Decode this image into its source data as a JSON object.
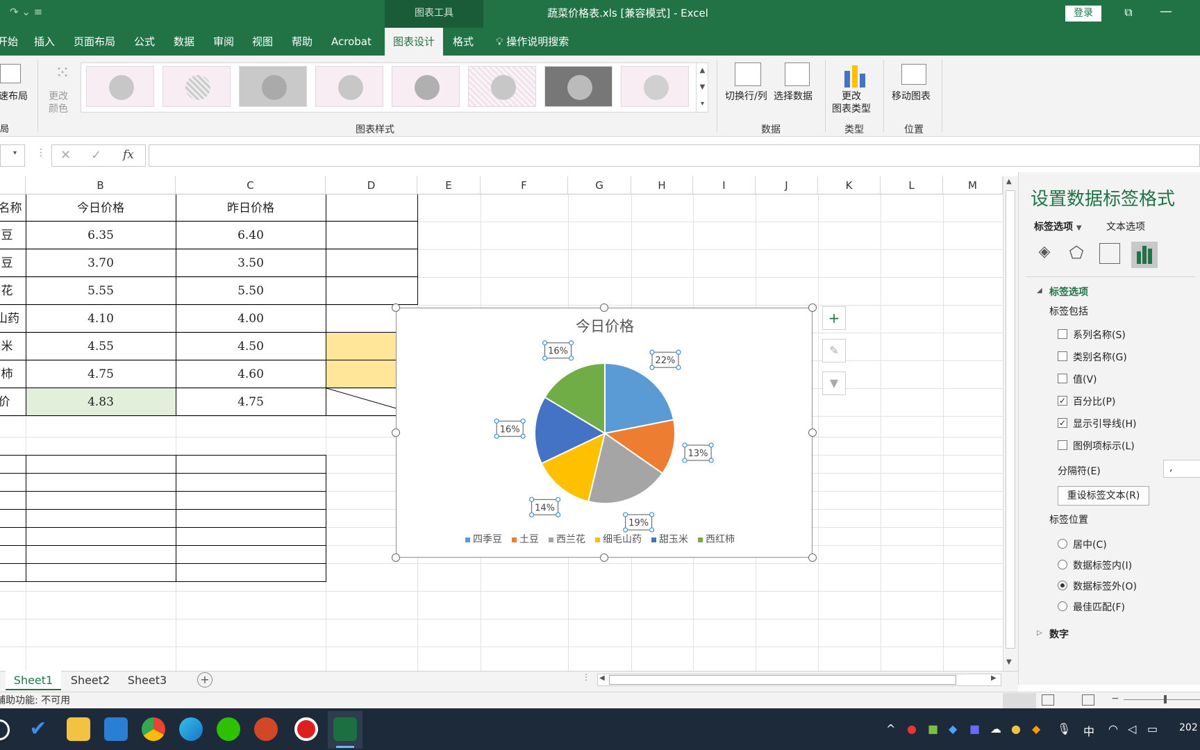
{
  "titlebar": {
    "context_tools": "图表工具",
    "document_title": "蔬菜价格表.xls  [兼容模式]  -  Excel",
    "login_label": "登录"
  },
  "tabs": [
    "开始",
    "插入",
    "页面布局",
    "公式",
    "数据",
    "审阅",
    "视图",
    "帮助",
    "Acrobat",
    "图表设计",
    "格式"
  ],
  "active_tab": "图表设计",
  "tell_me": "操作说明搜索",
  "ribbon": {
    "quick_layout": "速布局",
    "change_colors": "更改\n颜色",
    "chart_styles_group": "图表样式",
    "switch_row_col": "切换行/列",
    "select_data": "选择数据",
    "data_group": "数据",
    "change_chart_type": "更改\n图表类型",
    "type_group": "类型",
    "move_chart": "移动图表",
    "location_group": "位置",
    "layout_group_fragment": "局"
  },
  "formula_bar": {
    "fx": "fx",
    "value": ""
  },
  "sheet": {
    "columns": [
      "B",
      "C",
      "D",
      "E",
      "F",
      "G",
      "H",
      "I",
      "J",
      "K",
      "L",
      "M"
    ],
    "header_row": [
      "名称",
      "今日价格",
      "昨日价格"
    ],
    "rows": [
      {
        "name": "豆",
        "today": "6.35",
        "yesterday": "6.40"
      },
      {
        "name": "豆",
        "today": "3.70",
        "yesterday": "3.50"
      },
      {
        "name": "花",
        "today": "5.55",
        "yesterday": "5.50"
      },
      {
        "name": "山药",
        "today": "4.10",
        "yesterday": "4.00"
      },
      {
        "name": "米",
        "today": "4.55",
        "yesterday": "4.50"
      },
      {
        "name": "柿",
        "today": "4.75",
        "yesterday": "4.60"
      },
      {
        "name": "价",
        "today": "4.83",
        "yesterday": "4.75"
      }
    ],
    "highlight_today_avg": "#e2efda",
    "highlight_d": "#ffe699"
  },
  "chart_data": {
    "type": "pie",
    "title": "今日价格",
    "categories": [
      "四季豆",
      "土豆",
      "西兰花",
      "细毛山药",
      "甜玉米",
      "西红柿"
    ],
    "values": [
      6.35,
      3.7,
      5.55,
      4.1,
      4.55,
      4.75
    ],
    "percent_labels": [
      "22%",
      "13%",
      "19%",
      "14%",
      "16%",
      "16%"
    ],
    "colors": [
      "#5b9bd5",
      "#ed7d31",
      "#a5a5a5",
      "#ffc000",
      "#4472c4",
      "#70ad47"
    ],
    "legend_position": "bottom",
    "labels_position": "outside-end"
  },
  "pane": {
    "title": "设置数据标签格式",
    "tab_label_options": "标签选项",
    "tab_text_options": "文本选项",
    "section": "标签选项",
    "label_contains": "标签包括",
    "checks": [
      {
        "label": "系列名称(S)",
        "checked": false
      },
      {
        "label": "类别名称(G)",
        "checked": false
      },
      {
        "label": "值(V)",
        "checked": false
      },
      {
        "label": "百分比(P)",
        "checked": true
      },
      {
        "label": "显示引导线(H)",
        "checked": true
      },
      {
        "label": "图例项标示(L)",
        "checked": false
      }
    ],
    "separator_label": "分隔符(E)",
    "separator_value": ",",
    "reset_button": "重设标签文本(R)",
    "label_position": "标签位置",
    "positions": [
      {
        "label": "居中(C)",
        "selected": false
      },
      {
        "label": "数据标签内(I)",
        "selected": false
      },
      {
        "label": "数据标签外(O)",
        "selected": true
      },
      {
        "label": "最佳匹配(F)",
        "selected": false
      }
    ],
    "number_section": "数字"
  },
  "sheet_tabs": [
    "Sheet1",
    "Sheet2",
    "Sheet3"
  ],
  "active_sheet": "Sheet1",
  "status": {
    "accessibility": "辅助功能: 不可用"
  },
  "taskbar": {
    "ime": "中",
    "clock_fragment": "202"
  }
}
